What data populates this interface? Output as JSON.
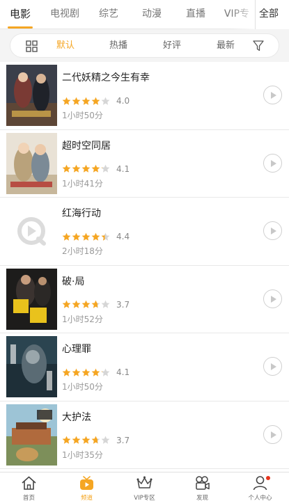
{
  "categories": {
    "items": [
      "电影",
      "电视剧",
      "综艺",
      "动漫",
      "直播",
      "VIP专"
    ],
    "active_index": 0,
    "all_label": "全部"
  },
  "sort": {
    "options": [
      "默认",
      "热播",
      "好评",
      "最新"
    ],
    "active_index": 0,
    "icons": [
      "grid-icon",
      "filter-icon"
    ]
  },
  "movies": [
    {
      "title": "二代妖精之今生有幸",
      "rating": 4.0,
      "rating_text": "4.0",
      "duration": "1小时50分",
      "poster": "movie-poster"
    },
    {
      "title": "超时空同居",
      "rating": 4.1,
      "rating_text": "4.1",
      "duration": "1小时41分",
      "poster": "movie-poster"
    },
    {
      "title": "红海行动",
      "rating": 4.4,
      "rating_text": "4.4",
      "duration": "2小时18分",
      "poster": "placeholder-play-logo"
    },
    {
      "title": "破·局",
      "rating": 3.7,
      "rating_text": "3.7",
      "duration": "1小时52分",
      "poster": "movie-poster"
    },
    {
      "title": "心理罪",
      "rating": 4.1,
      "rating_text": "4.1",
      "duration": "1小时50分",
      "poster": "movie-poster"
    },
    {
      "title": "大护法",
      "rating": 3.7,
      "rating_text": "3.7",
      "duration": "1小时35分",
      "poster": "movie-poster"
    }
  ],
  "bottom_nav": {
    "items": [
      {
        "label": "首页",
        "icon": "home-icon"
      },
      {
        "label": "频道",
        "icon": "channel-tv-icon"
      },
      {
        "label": "VIP专区",
        "icon": "crown-icon"
      },
      {
        "label": "发现",
        "icon": "camera-icon"
      },
      {
        "label": "个人中心",
        "icon": "user-icon"
      }
    ],
    "active_index": 1,
    "notification_dot_on": "个人中心"
  },
  "colors": {
    "accent": "#f5a623",
    "star_empty": "#d6d6d6",
    "badge": "#e8341c"
  }
}
